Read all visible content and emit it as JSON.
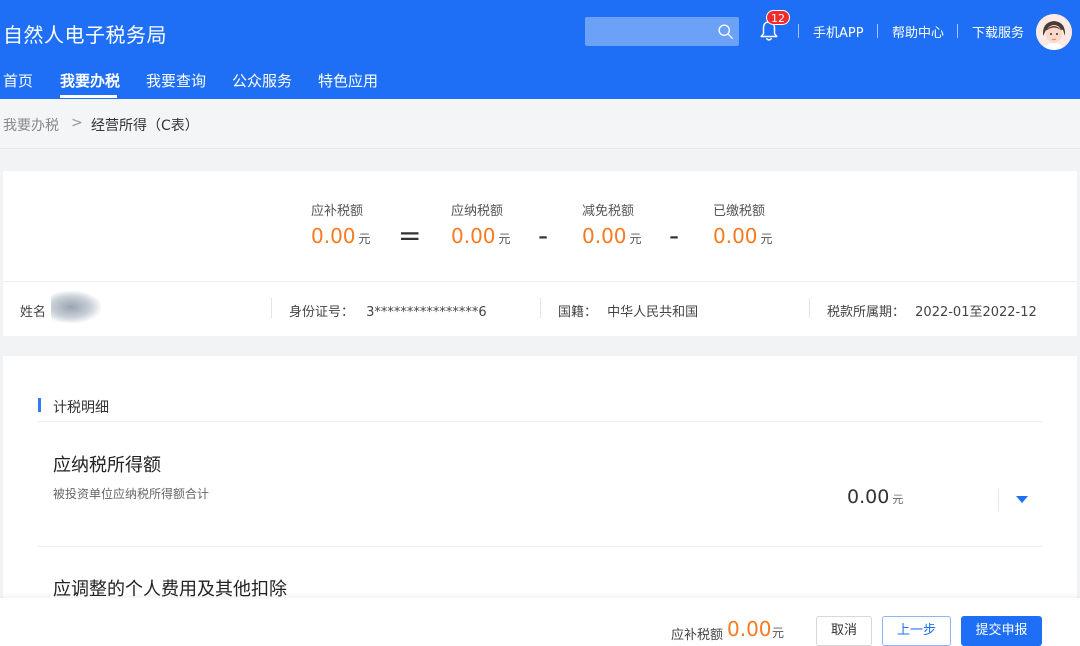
{
  "header": {
    "brand": "自然人电子税务局",
    "notification_count": "12",
    "links": [
      "手机APP",
      "帮助中心",
      "下载服务"
    ]
  },
  "nav": {
    "items": [
      "首页",
      "我要办税",
      "我要查询",
      "公众服务",
      "特色应用"
    ],
    "active": "我要办税"
  },
  "breadcrumb": {
    "home": "我要办税",
    "separator": ">",
    "current": "经营所得（C表）"
  },
  "summary": {
    "equation": [
      {
        "label": "应补税额",
        "value": "0.00",
        "unit": "元"
      },
      {
        "label": "应纳税额",
        "value": "0.00",
        "unit": "元"
      },
      {
        "label": "减免税额",
        "value": "0.00",
        "unit": "元"
      },
      {
        "label": "已缴税额",
        "value": "0.00",
        "unit": "元"
      }
    ],
    "operators": [
      "=",
      "-",
      "-"
    ],
    "info": {
      "name_label": "姓名",
      "id_label": "身份证号：",
      "id_value": "3****************6",
      "nationality_label": "国籍：",
      "nationality_value": "中华人民共和国",
      "period_label": "税款所属期：",
      "period_value": "2022-01至2022-12"
    }
  },
  "detail": {
    "section_title": "计税明细",
    "rows": [
      {
        "title": "应纳税所得额",
        "subtitle": "被投资单位应纳税所得额合计",
        "value": "0.00",
        "unit": "元"
      },
      {
        "title": "应调整的个人费用及其他扣除"
      }
    ]
  },
  "footer": {
    "label": "应补税额",
    "value": "0.00",
    "unit": "元",
    "buttons": {
      "cancel": "取消",
      "prev": "上一步",
      "submit": "提交申报"
    }
  },
  "colors": {
    "primary": "#1e6ff5",
    "accent": "#f57a21",
    "badge": "#ef2b2b"
  }
}
